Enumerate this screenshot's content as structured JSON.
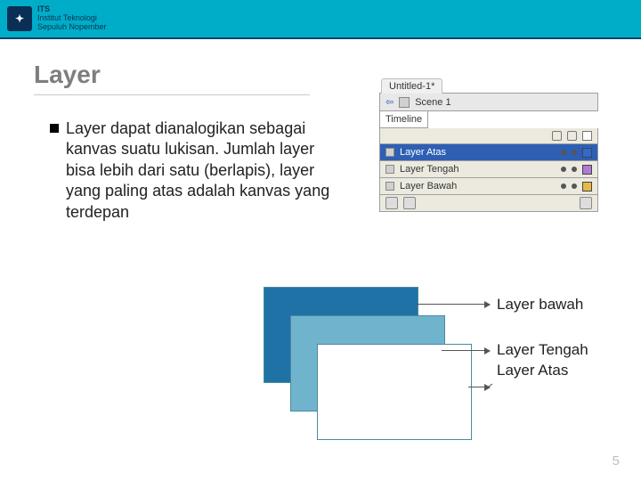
{
  "header": {
    "org_abbrev": "ITS",
    "org_line1": "Institut",
    "org_line2": "Teknologi",
    "org_line3": "Sepuluh Nopember"
  },
  "title": "Layer",
  "bullet_text": "Layer dapat dianalogikan sebagai kanvas suatu lukisan. Jumlah layer bisa lebih dari satu (berlapis), layer yang paling atas adalah kanvas yang terdepan",
  "panel": {
    "doc_tab": "Untitled-1*",
    "timeline_label": "Timeline",
    "scene_label": "Scene 1",
    "layers": [
      {
        "name": "Layer Atas",
        "chip": "#2d6ad6",
        "selected": true
      },
      {
        "name": "Layer Tengah",
        "chip": "#b07bd6",
        "selected": false
      },
      {
        "name": "Layer Bawah",
        "chip": "#e8b84a",
        "selected": false
      }
    ]
  },
  "diagram_labels": {
    "bottom": "Layer bawah",
    "middle": "Layer Tengah",
    "top": "Layer Atas"
  },
  "page_number": "5"
}
